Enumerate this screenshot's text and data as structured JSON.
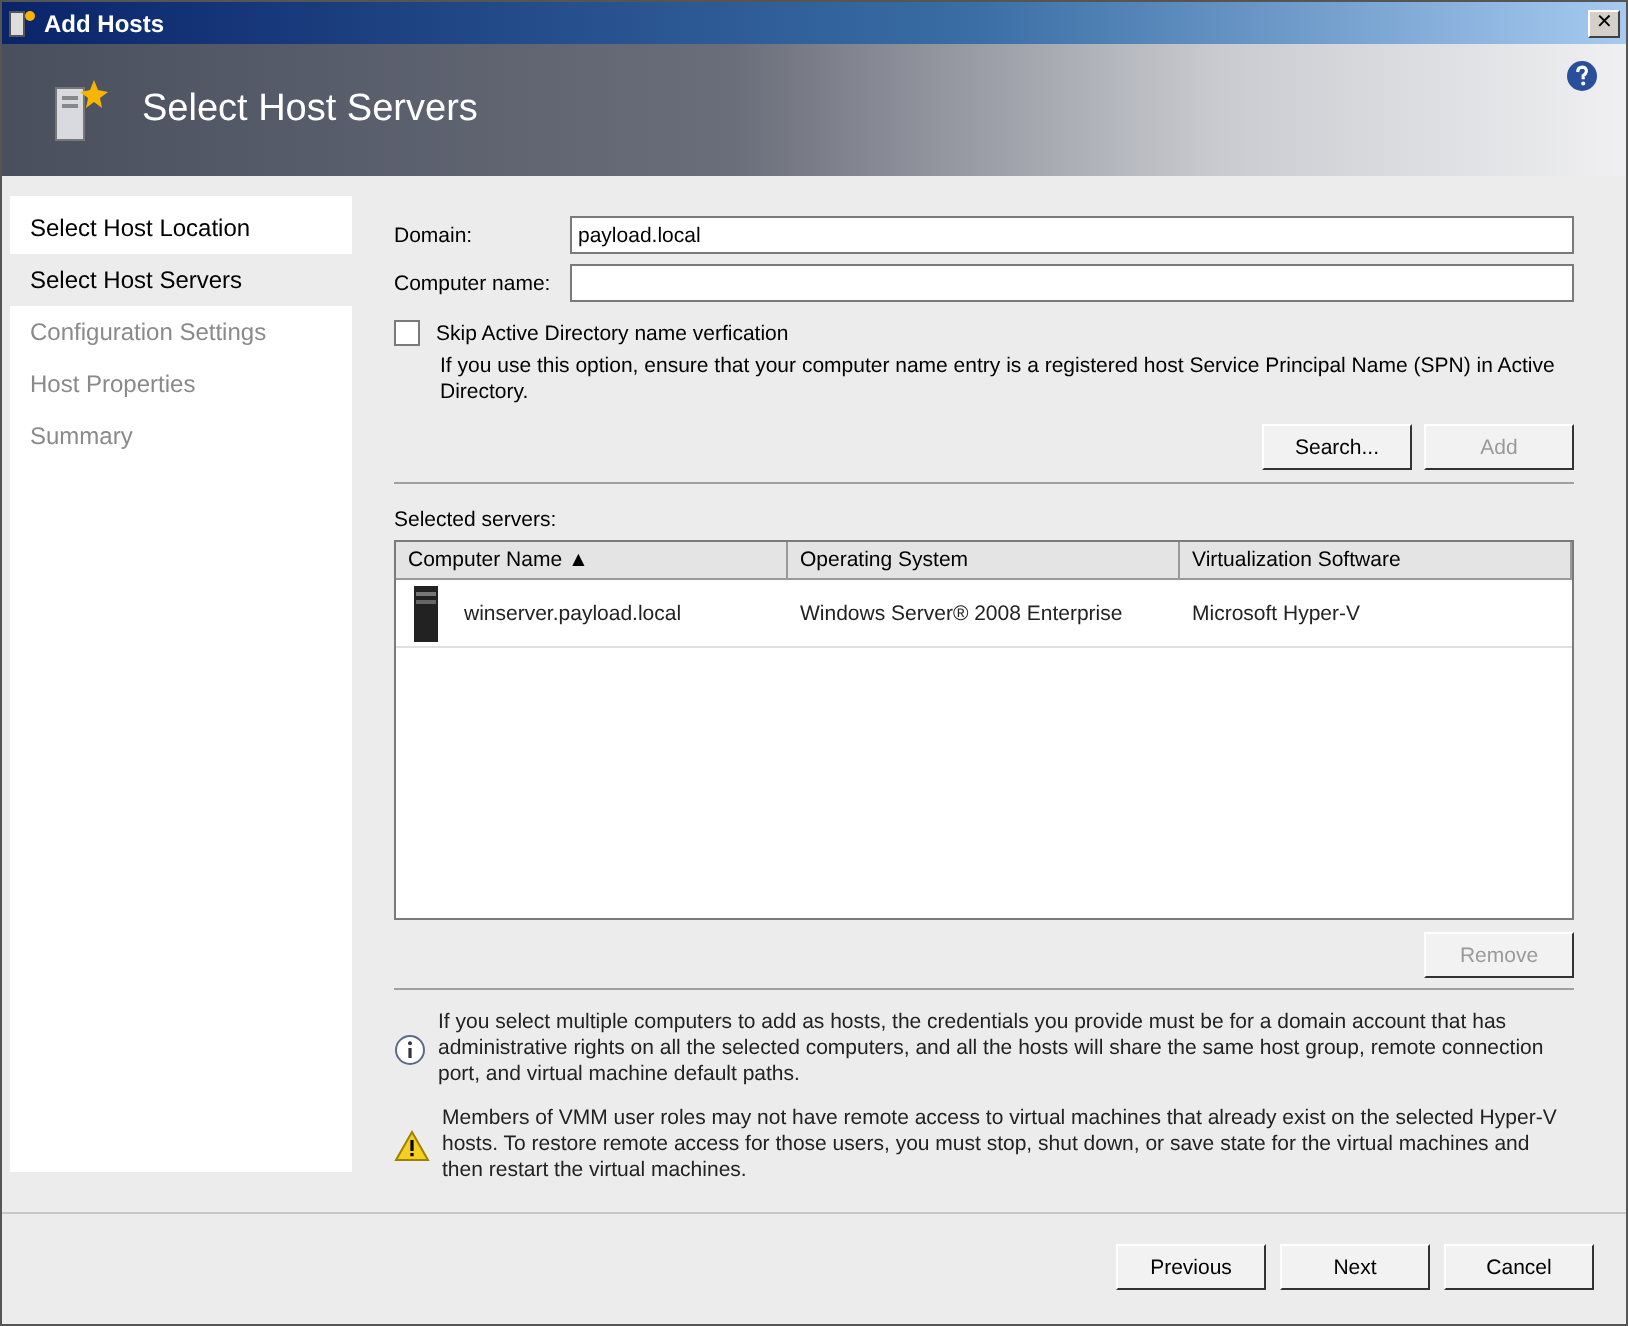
{
  "window": {
    "title": "Add Hosts",
    "close": "✕"
  },
  "header": {
    "title": "Select Host Servers"
  },
  "steps": [
    {
      "label": "Select Host Location",
      "selected": false,
      "disabled": false
    },
    {
      "label": "Select Host Servers",
      "selected": true,
      "disabled": false
    },
    {
      "label": "Configuration Settings",
      "selected": false,
      "disabled": true
    },
    {
      "label": "Host Properties",
      "selected": false,
      "disabled": true
    },
    {
      "label": "Summary",
      "selected": false,
      "disabled": true
    }
  ],
  "domain": {
    "label": "Domain:",
    "value": "payload.local"
  },
  "computer_name": {
    "label": "Computer name:"
  },
  "skip_verification": {
    "label": "Skip Active Directory name verfication",
    "checked": false,
    "note": "If you use this option, ensure that your computer name entry is a registered host Service Principal Name (SPN) in Active Directory."
  },
  "search_buttons": [
    {
      "label": "Search...",
      "disabled": false
    },
    {
      "label": "Add",
      "disabled": true
    }
  ],
  "selected_servers": {
    "label": "Selected servers:",
    "columns": [
      "Computer Name ▲",
      "Operating System",
      "Virtualization Software"
    ],
    "rows": [
      [
        "winserver.payload.local",
        "Windows Server® 2008 Enterprise",
        "Microsoft Hyper-V"
      ]
    ]
  },
  "remove_button": {
    "label": "Remove",
    "disabled": true
  },
  "notes": [
    {
      "kind": "info",
      "text": "If you select multiple computers to add as hosts, the credentials you provide must be for a domain account that has administrative rights on all the selected computers, and all the hosts will share the same host group, remote connection port, and virtual machine default paths."
    },
    {
      "kind": "warning",
      "text": "Members of VMM user roles may not have remote access to virtual machines that already exist on the selected Hyper-V hosts. To restore remote access for those users, you must stop, shut down, or save state for the virtual machines and then restart the virtual machines."
    }
  ],
  "footer_buttons": [
    {
      "label": "Previous",
      "disabled": false
    },
    {
      "label": "Next",
      "disabled": false
    },
    {
      "label": "Cancel",
      "disabled": false
    }
  ]
}
